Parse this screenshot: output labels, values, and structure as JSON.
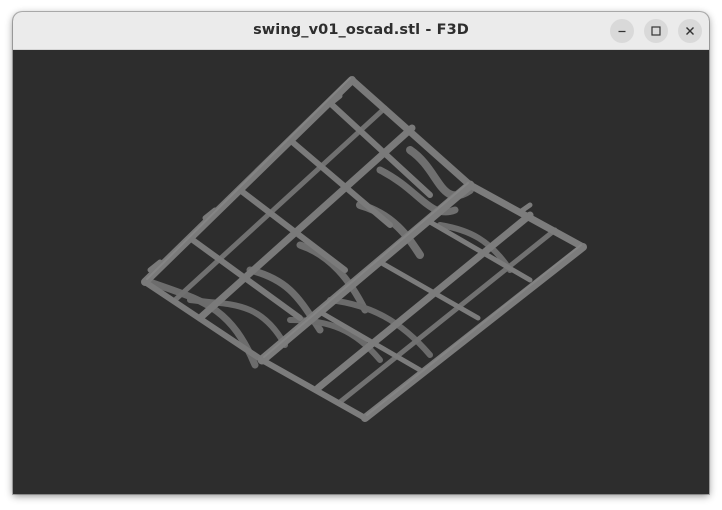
{
  "window": {
    "title": "swing_v01_oscad.stl - F3D"
  },
  "controls": {
    "minimize_icon": "minimize-icon",
    "maximize_icon": "maximize-icon",
    "close_icon": "close-icon"
  },
  "viewport": {
    "background_color": "#2d2d2d",
    "model_color": "#787878"
  }
}
